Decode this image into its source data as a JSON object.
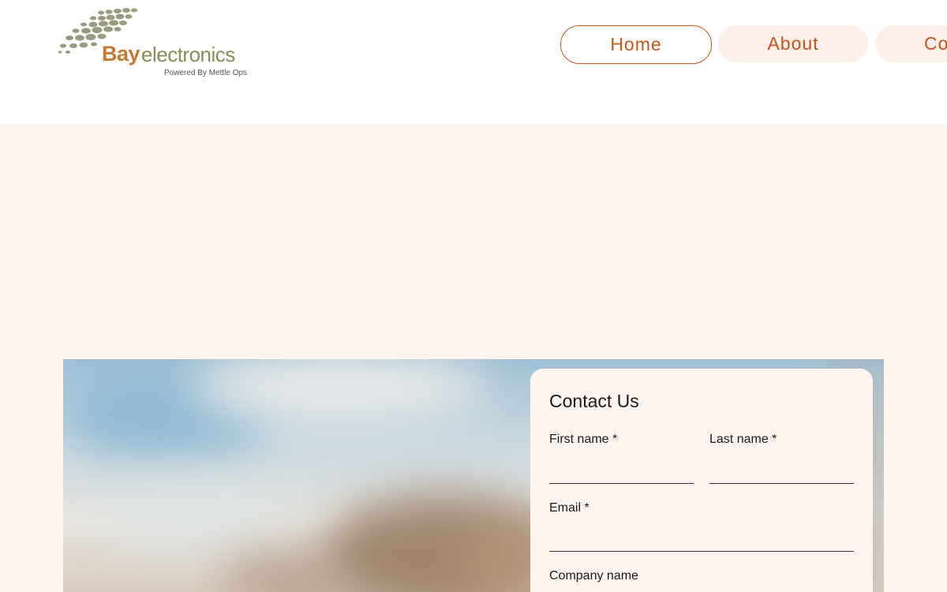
{
  "brand": {
    "name_bold": "Bay",
    "name_rest": "electronics",
    "tagline": "Powered By Mettle Ops",
    "logo_icon": "dotted-swoosh-logo",
    "colors": {
      "bay": "#c57a34",
      "electronics": "#8a8b5a",
      "dots": "#9a9a7e"
    }
  },
  "nav": {
    "items": [
      {
        "label": "Home",
        "active": true
      },
      {
        "label": "About",
        "active": false
      },
      {
        "label": "Co",
        "active": false
      }
    ],
    "accent_color": "#c2561b"
  },
  "hero": {
    "background_color": "#fdf4ef"
  },
  "contact": {
    "title": "Contact Us",
    "first_name_label": "First name *",
    "first_name_value": "",
    "last_name_label": "Last name *",
    "last_name_value": "",
    "email_label": "Email *",
    "email_value": "",
    "company_label": "Company name"
  }
}
